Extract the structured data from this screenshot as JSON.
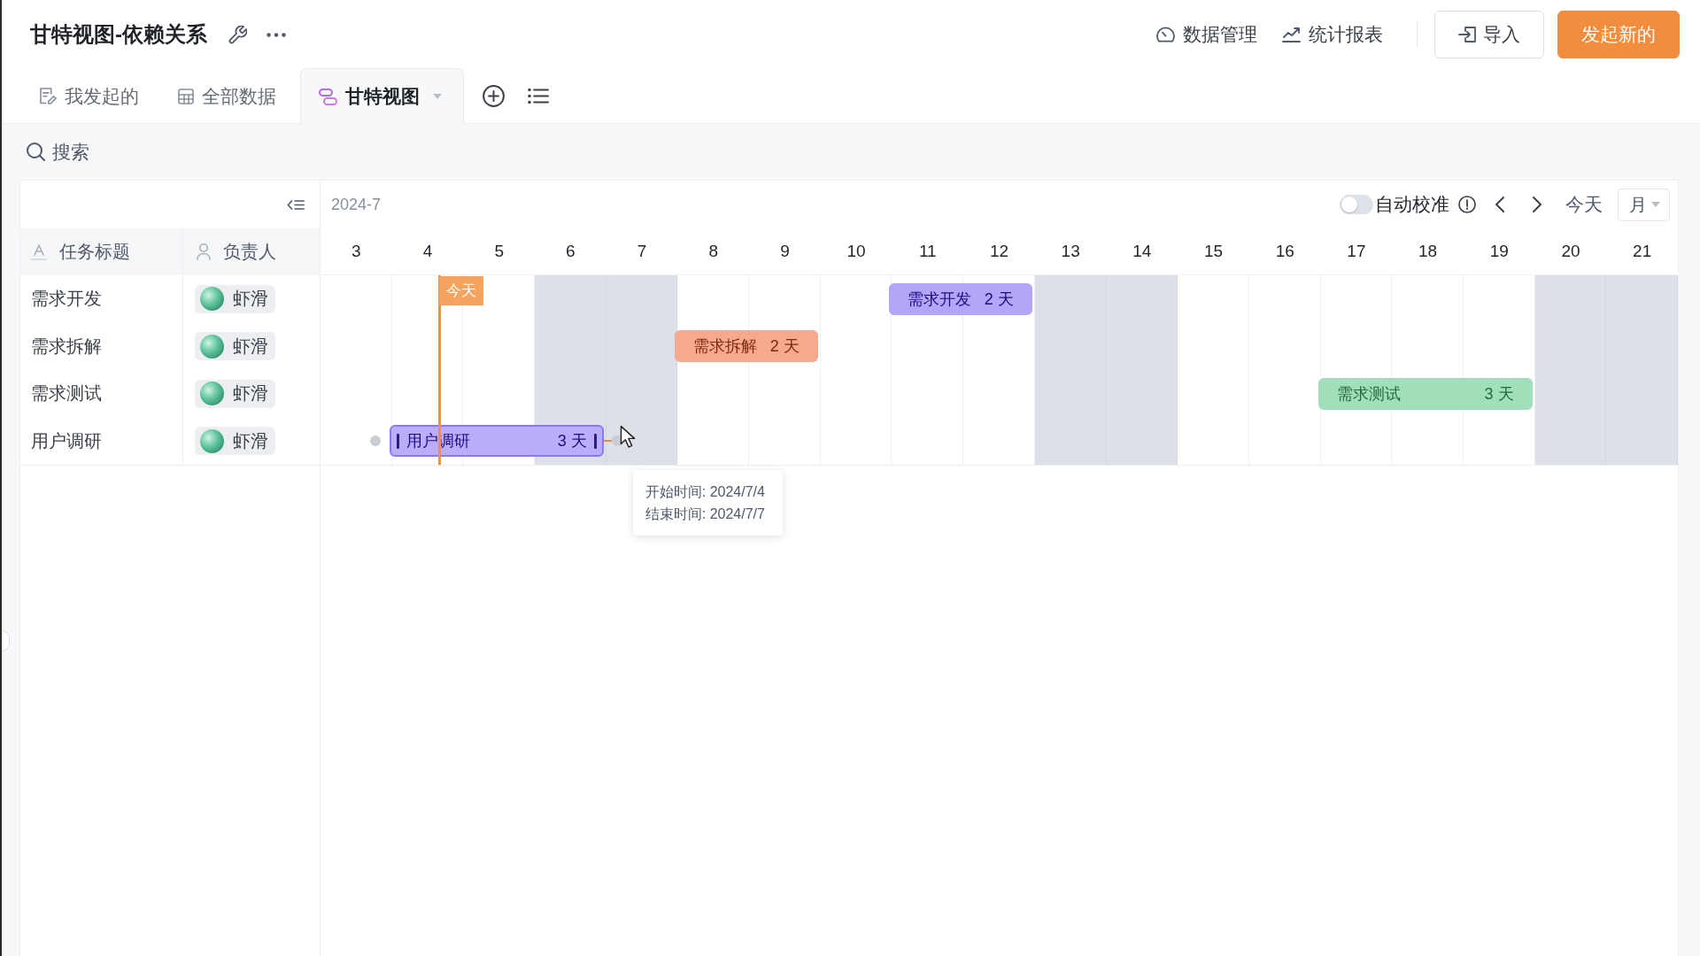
{
  "header": {
    "title": "甘特视图-依赖关系",
    "links": [
      "数据管理",
      "统计报表"
    ],
    "buttons": [
      {
        "label": "导入",
        "kind": "secondary"
      },
      {
        "label": "发起新的",
        "kind": "primary"
      }
    ]
  },
  "tabs": [
    {
      "label": "我发起的",
      "selected": false
    },
    {
      "label": "全部数据",
      "selected": false
    },
    {
      "label": "甘特视图",
      "selected": true
    }
  ],
  "search": {
    "placeholder": "搜索"
  },
  "gantt": {
    "toolbar": {
      "month": "2024-7",
      "auto_align": {
        "label": "自动校准",
        "on": false
      },
      "today_button": "今天",
      "scale": "月"
    },
    "columns": [
      "任务标题",
      "负责人"
    ],
    "days": [
      {
        "label": "3",
        "weekend": false
      },
      {
        "label": "4",
        "weekend": false
      },
      {
        "label": "5",
        "weekend": false
      },
      {
        "label": "6",
        "weekend": true
      },
      {
        "label": "7",
        "weekend": true
      },
      {
        "label": "8",
        "weekend": false
      },
      {
        "label": "9",
        "weekend": false
      },
      {
        "label": "10",
        "weekend": false
      },
      {
        "label": "11",
        "weekend": false
      },
      {
        "label": "12",
        "weekend": false
      },
      {
        "label": "13",
        "weekend": true
      },
      {
        "label": "14",
        "weekend": true
      },
      {
        "label": "15",
        "weekend": false
      },
      {
        "label": "16",
        "weekend": false
      },
      {
        "label": "17",
        "weekend": false
      },
      {
        "label": "18",
        "weekend": false
      },
      {
        "label": "19",
        "weekend": false
      },
      {
        "label": "20",
        "weekend": true
      },
      {
        "label": "21",
        "weekend": true
      }
    ],
    "today_marker": "今天",
    "rows": [
      {
        "title": "需求开发",
        "owner": "虾滑",
        "bar": {
          "label": "需求开发",
          "duration": "2 天",
          "color": "#b3a5f8",
          "hovered": false
        }
      },
      {
        "title": "需求拆解",
        "owner": "虾滑",
        "bar": {
          "label": "需求拆解",
          "duration": "2 天",
          "color": "#f5a98f",
          "hovered": false
        }
      },
      {
        "title": "需求测试",
        "owner": "虾滑",
        "bar": {
          "label": "需求测试",
          "duration": "3 天",
          "color": "#a0dfba",
          "hovered": false
        }
      },
      {
        "title": "用户调研",
        "owner": "虾滑",
        "bar": {
          "label": "用户调研",
          "duration": "3 天",
          "color": "#baaefc",
          "hovered": true,
          "tooltip": [
            "开始时间: 2024/7/4",
            "结束时间: 2024/7/7"
          ]
        }
      }
    ]
  }
}
